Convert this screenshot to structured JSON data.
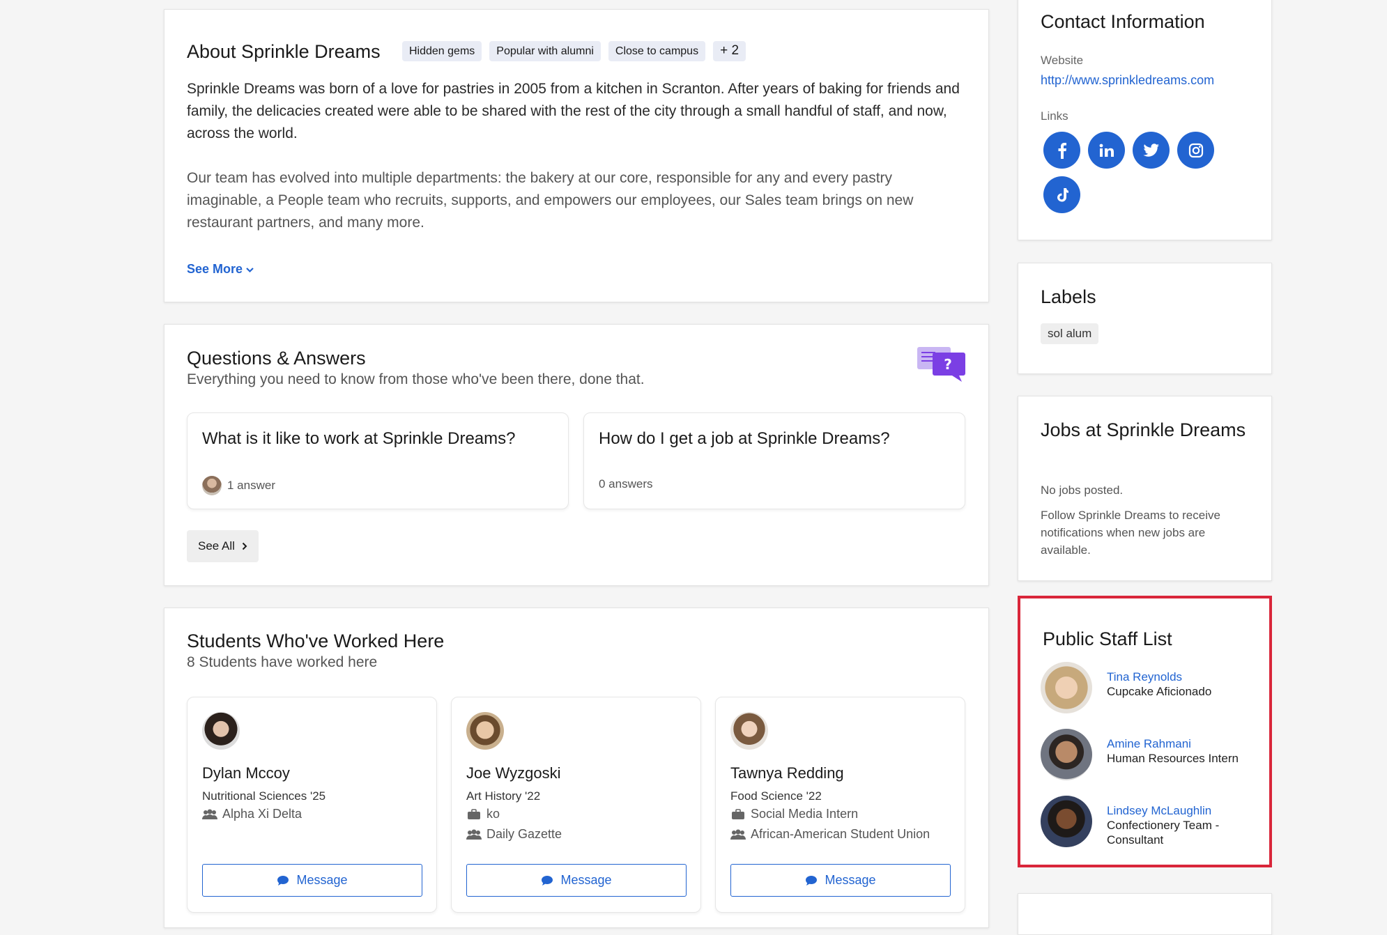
{
  "about": {
    "title": "About Sprinkle Dreams",
    "tags": [
      "Hidden gems",
      "Popular with alumni",
      "Close to campus",
      "+ 2"
    ],
    "paragraph1": "Sprinkle Dreams was born of a love for pastries in 2005 from a kitchen in Scranton. After years of baking for friends and family, the delicacies created were able to be shared with the rest of the city through a small handful of staff, and now, across the world.",
    "paragraph2": "Our team has evolved into multiple departments: the bakery at our core, responsible for any and every pastry imaginable, a People team who recruits, supports, and empowers our employees, our Sales team brings on new restaurant partners, and many more.",
    "see_more": "See More"
  },
  "qa": {
    "title": "Questions & Answers",
    "subtitle": "Everything you need to know from those who've been there, done that.",
    "questions": [
      {
        "text": "What is it like to work at Sprinkle Dreams?",
        "answers": "1 answer"
      },
      {
        "text": "How do I get a job at Sprinkle Dreams?",
        "answers": "0 answers"
      }
    ],
    "see_all": "See All"
  },
  "students": {
    "title": "Students Who've Worked Here",
    "subtitle": "8 Students have worked here",
    "cards": [
      {
        "name": "Dylan Mccoy",
        "major": "Nutritional Sciences '25",
        "group": "Alpha Xi Delta"
      },
      {
        "name": "Joe Wyzgoski",
        "major": "Art History '22",
        "job": "ko",
        "group": "Daily Gazette"
      },
      {
        "name": "Tawnya Redding",
        "major": "Food Science '22",
        "job": "Social Media Intern",
        "group": "African-American Student Union"
      }
    ],
    "message_label": "Message"
  },
  "contact": {
    "title": "Contact Information",
    "website_label": "Website",
    "website_url": "http://www.sprinkledreams.com",
    "links_label": "Links",
    "socials": [
      "facebook-icon",
      "linkedin-icon",
      "twitter-icon",
      "instagram-icon",
      "tiktok-icon"
    ]
  },
  "labels": {
    "title": "Labels",
    "items": [
      "sol alum"
    ]
  },
  "jobs": {
    "title": "Jobs at Sprinkle Dreams",
    "none": "No jobs posted.",
    "follow": "Follow Sprinkle Dreams to receive notifications when new jobs are available."
  },
  "staff": {
    "title": "Public Staff List",
    "members": [
      {
        "name": "Tina Reynolds",
        "title": "Cupcake Aficionado"
      },
      {
        "name": "Amine Rahmani",
        "title": "Human Resources Intern"
      },
      {
        "name": "Lindsey McLaughlin",
        "title": "Confectionery Team - Consultant"
      }
    ]
  },
  "colors": {
    "accent": "#2264d1",
    "highlight": "#d9263a",
    "qa_icon": "#7b3fe4"
  }
}
